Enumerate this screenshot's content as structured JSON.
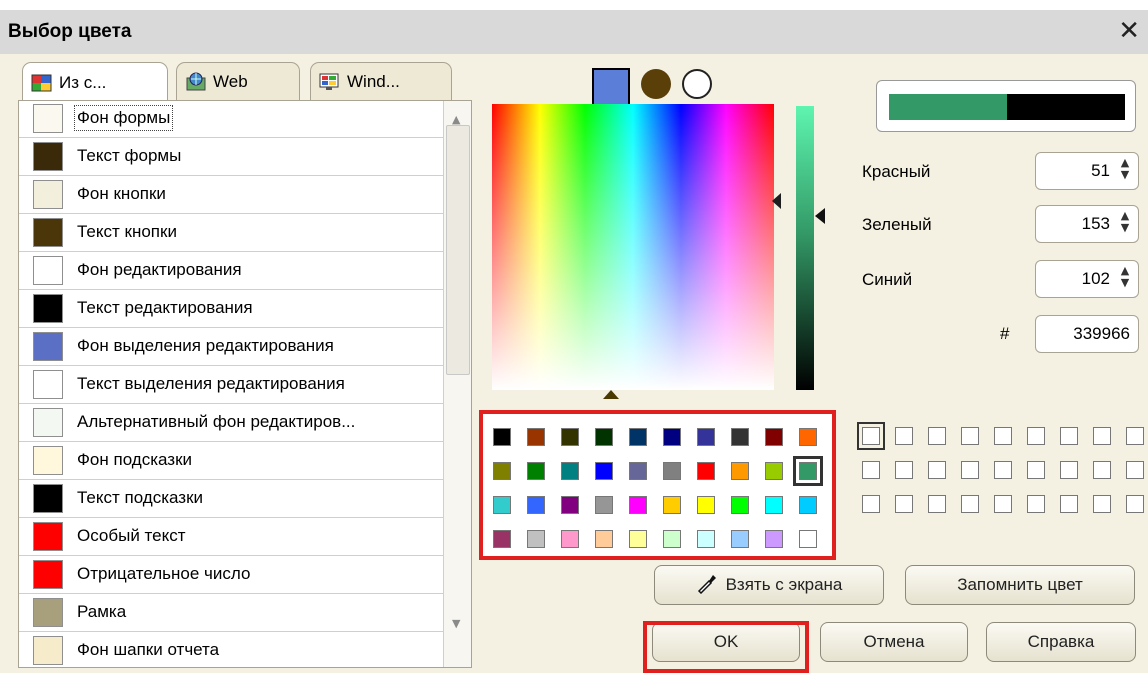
{
  "window": {
    "title": "Выбор цвета",
    "close_icon": "close-icon"
  },
  "tabs": [
    {
      "label": "Из с...",
      "icon": "style-palette-icon",
      "active": true
    },
    {
      "label": "Web",
      "icon": "web-globe-icon",
      "active": false
    },
    {
      "label": "Wind...",
      "icon": "windows-monitor-icon",
      "active": false
    }
  ],
  "color_list": [
    {
      "label": "Фон формы",
      "color": "#fbf9ef"
    },
    {
      "label": "Текст формы",
      "color": "#3a2a0a"
    },
    {
      "label": "Фон кнопки",
      "color": "#f3efdd"
    },
    {
      "label": "Текст кнопки",
      "color": "#4a3608"
    },
    {
      "label": "Фон редактирования",
      "color": "#ffffff"
    },
    {
      "label": "Текст редактирования",
      "color": "#000000"
    },
    {
      "label": "Фон выделения редактирования",
      "color": "#5b6fc4"
    },
    {
      "label": "Текст выделения редактирования",
      "color": "#ffffff"
    },
    {
      "label": "Альтернативный фон редактиров...",
      "color": "#f3f8f2"
    },
    {
      "label": "Фон подсказки",
      "color": "#fff8dc"
    },
    {
      "label": "Текст подсказки",
      "color": "#000000"
    },
    {
      "label": "Особый текст",
      "color": "#ff0000"
    },
    {
      "label": "Отрицательное число",
      "color": "#ff0000"
    },
    {
      "label": "Рамка",
      "color": "#a89f7c"
    },
    {
      "label": "Фон шапки отчета",
      "color": "#f6eccb"
    }
  ],
  "fields": {
    "red_label": "Красный",
    "red_value": "51",
    "green_label": "Зеленый",
    "green_value": "153",
    "blue_label": "Синий",
    "blue_value": "102",
    "hex_label": "#",
    "hex_value": "339966"
  },
  "preview": {
    "new_color": "#339966",
    "old_color": "#000000"
  },
  "palette": [
    [
      "#000000",
      "#993300",
      "#333300",
      "#003300",
      "#003366",
      "#000080",
      "#333399",
      "#333333",
      "#800000",
      "#ff6600"
    ],
    [
      "#808000",
      "#008000",
      "#008080",
      "#0000ff",
      "#666699",
      "#808080",
      "#ff0000",
      "#ff9900",
      "#99cc00",
      "#339966"
    ],
    [
      "#33cccc",
      "#3366ff",
      "#800080",
      "#969696",
      "#ff00ff",
      "#ffcc00",
      "#ffff00",
      "#00ff00",
      "#00ffff",
      "#00ccff"
    ],
    [
      "#993366",
      "#c0c0c0",
      "#ff99cc",
      "#ffcc99",
      "#ffff99",
      "#ccffcc",
      "#ccffff",
      "#99ccff",
      "#cc99ff",
      "#ffffff"
    ]
  ],
  "selected_palette_color": "#339966",
  "buttons": {
    "pick_screen": "Взять с экрана",
    "remember_color": "Запомнить цвет",
    "ok": "OK",
    "cancel": "Отмена",
    "help": "Справка"
  }
}
